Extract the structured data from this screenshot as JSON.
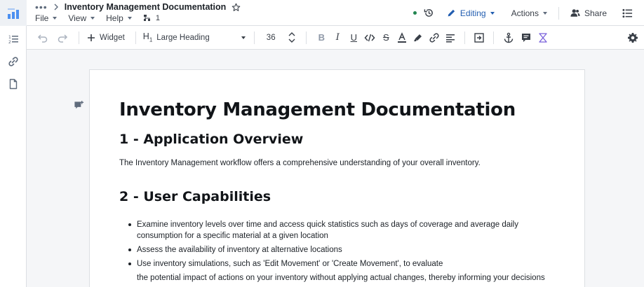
{
  "header": {
    "title": "Inventory Management Documentation",
    "menus": [
      {
        "label": "File"
      },
      {
        "label": "View"
      },
      {
        "label": "Help"
      }
    ],
    "page_count": "1",
    "status_color": "#238551",
    "editing_label": "Editing",
    "actions_label": "Actions",
    "share_label": "Share"
  },
  "toolbar": {
    "widget_label": "Widget",
    "heading_prefix": "H",
    "heading_sub": "1",
    "heading_style": "Large Heading",
    "font_size": "36"
  },
  "document": {
    "title": "Inventory Management Documentation",
    "section1": {
      "heading": "1 - Application Overview",
      "text": "The Inventory Management workflow offers a comprehensive understanding of your overall inventory."
    },
    "section2": {
      "heading": "2 - User Capabilities",
      "bullets": [
        "Examine inventory levels over time and access quick statistics such as days of coverage and average daily consumption for a specific material at a given location",
        "Assess the availability of inventory at alternative locations",
        "Use inventory simulations, such as 'Edit Movement' or 'Create Movement', to evaluate"
      ],
      "continuation": "the potential impact of actions on your inventory without applying actual changes, thereby informing your decisions"
    }
  },
  "colors": {
    "accent": "#215db0",
    "logo": "#4c90f0"
  }
}
